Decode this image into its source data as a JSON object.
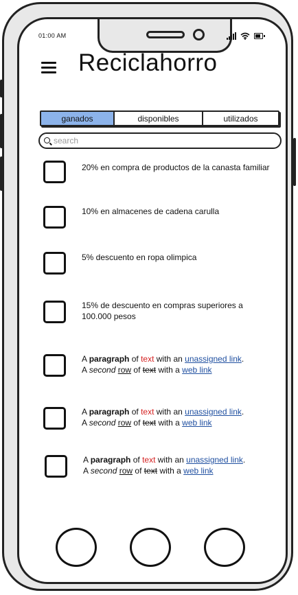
{
  "status_bar": {
    "time": "01:00 AM"
  },
  "header": {
    "title": "Reciclahorro"
  },
  "tabs": [
    {
      "label": "ganados",
      "active": true
    },
    {
      "label": "disponibles",
      "active": false
    },
    {
      "label": "utilizados",
      "active": false
    }
  ],
  "search": {
    "placeholder": "search"
  },
  "coupons": [
    {
      "text": "20% en compra de productos de la canasta familiar"
    },
    {
      "text": "10% en almacenes de cadena carulla"
    },
    {
      "text": "5% descuento en ropa olimpica"
    },
    {
      "text": "15% de descuento en compras superiores a 100.000 pesos"
    }
  ],
  "sample_paragraph": {
    "a": "A",
    "paragraph": "paragraph",
    "of": "of",
    "text": "text",
    "with_an": "with an",
    "unassigned_link": "unassigned link",
    "period": ".",
    "a2": "A",
    "second": "second",
    "row": "row",
    "of2": "of",
    "text2": "text",
    "with_a": "with a",
    "web_link": "web link"
  },
  "colors": {
    "active_tab": "#8cb3ea",
    "link": "#1f4fa0",
    "red_text": "#d42020"
  },
  "bottom_nav": {
    "buttons": 3
  }
}
